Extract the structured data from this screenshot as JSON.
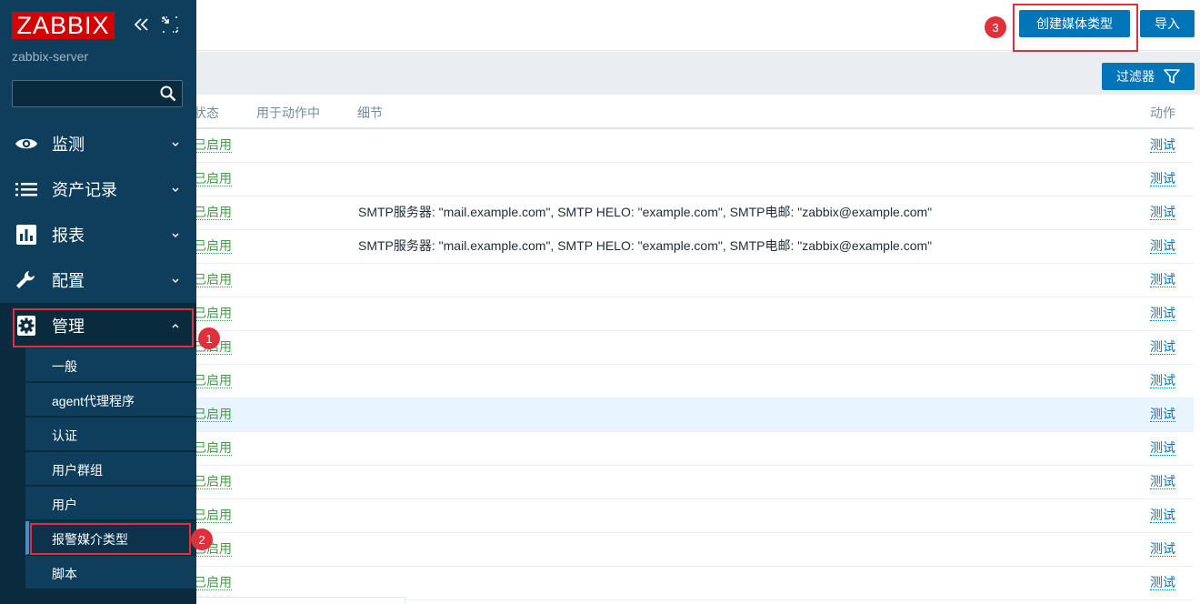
{
  "header": {
    "create_button": "创建媒体类型",
    "import_button": "导入"
  },
  "filter": {
    "button": "过滤器"
  },
  "table": {
    "columns": {
      "status": "状态",
      "used_in_actions": "用于动作中",
      "details": "细节",
      "actions": "动作"
    },
    "rows": [
      {
        "status": "已启用",
        "details": "",
        "action": "测试"
      },
      {
        "status": "已启用",
        "details": "",
        "action": "测试"
      },
      {
        "status": "已启用",
        "details": "SMTP服务器: \"mail.example.com\", SMTP HELO: \"example.com\", SMTP电邮: \"zabbix@example.com\"",
        "action": "测试"
      },
      {
        "status": "已启用",
        "details": "SMTP服务器: \"mail.example.com\", SMTP HELO: \"example.com\", SMTP电邮: \"zabbix@example.com\"",
        "action": "测试"
      },
      {
        "status": "已启用",
        "details": "",
        "action": "测试"
      },
      {
        "status": "已启用",
        "details": "",
        "action": "测试"
      },
      {
        "status": "已启用",
        "details": "",
        "action": "测试"
      },
      {
        "status": "已启用",
        "details": "",
        "action": "测试"
      },
      {
        "status": "已启用",
        "details": "",
        "action": "测试"
      },
      {
        "status": "已启用",
        "details": "",
        "action": "测试"
      },
      {
        "status": "已启用",
        "details": "",
        "action": "测试"
      },
      {
        "status": "已启用",
        "details": "",
        "action": "测试"
      },
      {
        "status": "已启用",
        "details": "",
        "action": "测试"
      },
      {
        "status": "已启用",
        "details": "",
        "action": "测试"
      }
    ]
  },
  "sidebar": {
    "logo": "ZABBIX",
    "server": "zabbix-server",
    "search_placeholder": "",
    "menu": [
      {
        "label": "监测",
        "icon": "eye-icon"
      },
      {
        "label": "资产记录",
        "icon": "list-icon"
      },
      {
        "label": "报表",
        "icon": "bar-chart-icon"
      },
      {
        "label": "配置",
        "icon": "wrench-icon"
      },
      {
        "label": "管理",
        "icon": "gear-icon"
      }
    ],
    "submenu": [
      "一般",
      "agent代理程序",
      "认证",
      "用户群组",
      "用户",
      "报警媒介类型",
      "脚本"
    ]
  },
  "annotations": [
    "1",
    "2",
    "3"
  ],
  "colors": {
    "sidebar": "#0f3e5d",
    "accent": "#0275b8",
    "enabled": "#429e47",
    "annotation": "#e0303b",
    "logo": "#d40000"
  }
}
